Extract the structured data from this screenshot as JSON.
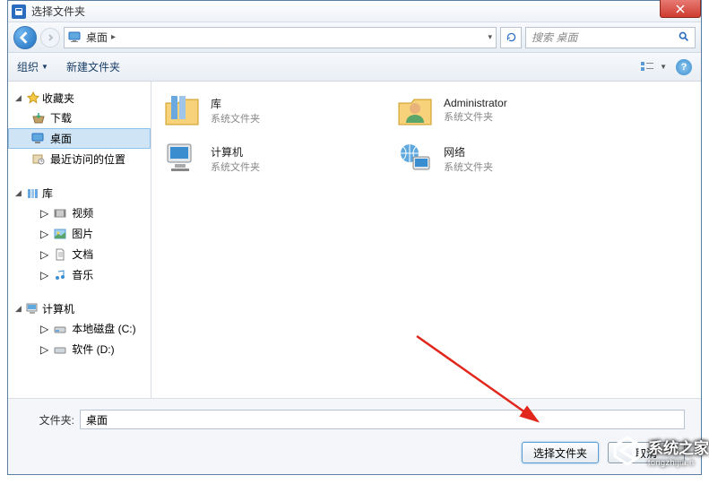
{
  "window": {
    "title": "选择文件夹"
  },
  "nav": {
    "location": "桌面",
    "search_placeholder": "搜索 桌面"
  },
  "toolbar": {
    "organize": "组织",
    "new_folder": "新建文件夹"
  },
  "sidebar": {
    "favorites": {
      "label": "收藏夹",
      "children": [
        {
          "label": "下载",
          "icon": "download"
        },
        {
          "label": "桌面",
          "icon": "desktop",
          "selected": true
        },
        {
          "label": "最近访问的位置",
          "icon": "recent"
        }
      ]
    },
    "libraries": {
      "label": "库",
      "children": [
        {
          "label": "视频",
          "icon": "video"
        },
        {
          "label": "图片",
          "icon": "picture"
        },
        {
          "label": "文档",
          "icon": "document"
        },
        {
          "label": "音乐",
          "icon": "music"
        }
      ]
    },
    "computer": {
      "label": "计算机",
      "children": [
        {
          "label": "本地磁盘 (C:)",
          "icon": "disk"
        },
        {
          "label": "软件 (D:)",
          "icon": "disk"
        }
      ]
    }
  },
  "content": {
    "items": [
      {
        "name": "库",
        "sub": "系统文件夹",
        "icon": "libraries"
      },
      {
        "name": "Administrator",
        "sub": "系统文件夹",
        "icon": "user-folder"
      },
      {
        "name": "计算机",
        "sub": "系统文件夹",
        "icon": "computer"
      },
      {
        "name": "网络",
        "sub": "系统文件夹",
        "icon": "network"
      }
    ]
  },
  "footer": {
    "folder_label": "文件夹:",
    "folder_value": "桌面",
    "select_button": "选择文件夹",
    "cancel_button": "取消"
  },
  "watermark": {
    "text": "系统之家",
    "url_hint": "tongzhijia.n"
  }
}
